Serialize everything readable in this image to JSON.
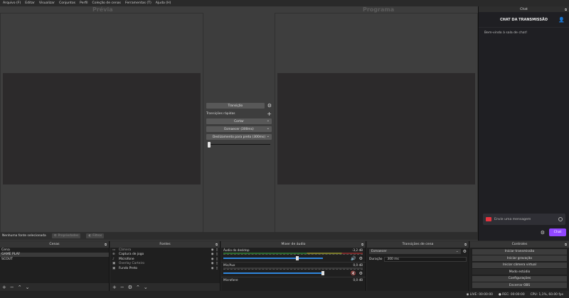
{
  "menu": [
    "Arquivo (F)",
    "Editar",
    "Visualizar",
    "Conjuntos",
    "Perfil",
    "Coleção de cenas",
    "Ferramentas (T)",
    "Ajuda (H)"
  ],
  "preview": {
    "title": "Prévia"
  },
  "program": {
    "title": "Programa"
  },
  "transition": {
    "button": "Transição",
    "quick_label": "Transições rápidas",
    "items": [
      "Cortar",
      "Esmaecer (300ms)",
      "Deslizamento para preto (300ms)"
    ]
  },
  "chat": {
    "tab": "Chat",
    "header": "CHAT DA TRANSMISSÃO",
    "welcome": "Bem-vindo à sala de chat!",
    "placeholder": "Envie uma mensagem",
    "send_label": "Chat"
  },
  "status": {
    "no_source": "Nenhuma fonte selecionada",
    "properties": "Propriedades",
    "filters": "Filtros"
  },
  "docks": {
    "scenes_title": "Cenas",
    "sources_title": "Fontes",
    "mixer_title": "Mixer de áudio",
    "transitions_title": "Transições de cena",
    "controls_title": "Controles"
  },
  "scenes": [
    "Cena",
    "GAME PLAY",
    "SCOUT"
  ],
  "sources": [
    {
      "name": "Câmera",
      "icon": "camera-icon"
    },
    {
      "name": "Captura de jogo",
      "icon": "gamepad-icon"
    },
    {
      "name": "Microfone",
      "icon": "microphone-icon"
    },
    {
      "name": "Overlay Carteiro",
      "icon": "image-icon"
    },
    {
      "name": "Fundo Preto",
      "icon": "image-icon"
    }
  ],
  "mixer": [
    {
      "name": "Áudio do desktop",
      "db": "-3,2 dB",
      "volume": 0.74
    },
    {
      "name": "Mic/Aux",
      "db": "0,0 dB",
      "volume": 1.0
    },
    {
      "name": "Microfone",
      "db": "0,0 dB",
      "volume": 1.0
    }
  ],
  "scene_transition": {
    "type": "Esmaecer",
    "duration_label": "Duração",
    "duration_value": "300 ms"
  },
  "controls": [
    "Iniciar transmissão",
    "Iniciar gravação",
    "Iniciar câmera virtual",
    "Modo estúdio",
    "Configurações",
    "Encerrar OBS"
  ],
  "footer": {
    "live": "LIVE: 00:00:00",
    "rec": "REC: 00:00:00",
    "cpu": "CPU: 1,1%, 60.00 fps"
  },
  "colors": {
    "accent": "#9147ff",
    "alert": "#e5343f",
    "volume": "#2f86dd"
  }
}
